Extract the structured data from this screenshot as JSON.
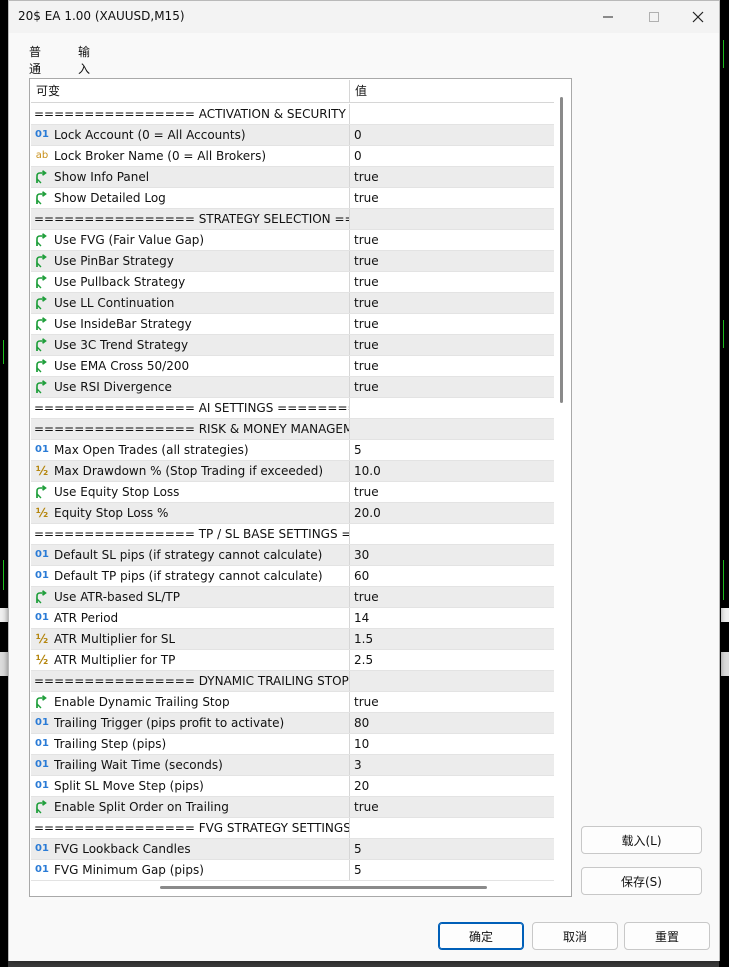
{
  "window": {
    "title": "20$ EA 1.00 (XAUUSD,M15)"
  },
  "tabs": [
    {
      "label": "普通"
    },
    {
      "label": "输入"
    }
  ],
  "grid": {
    "headers": {
      "variable": "可变",
      "value": "值"
    },
    "rows": [
      {
        "type": "sep",
        "name": "================ ACTIVATION & SECURITY =...",
        "value": ""
      },
      {
        "type": "int",
        "name": "Lock Account (0 = All Accounts)",
        "value": "0"
      },
      {
        "type": "str",
        "name": "Lock Broker Name (0 = All Brokers)",
        "value": "0"
      },
      {
        "type": "bool",
        "name": "Show Info Panel",
        "value": "true"
      },
      {
        "type": "bool",
        "name": "Show Detailed Log",
        "value": "true"
      },
      {
        "type": "sep",
        "name": "================ STRATEGY SELECTION ====...",
        "value": ""
      },
      {
        "type": "bool",
        "name": "Use FVG (Fair Value Gap)",
        "value": "true"
      },
      {
        "type": "bool",
        "name": "Use PinBar Strategy",
        "value": "true"
      },
      {
        "type": "bool",
        "name": "Use Pullback Strategy",
        "value": "true"
      },
      {
        "type": "bool",
        "name": "Use LL Continuation",
        "value": "true"
      },
      {
        "type": "bool",
        "name": "Use InsideBar Strategy",
        "value": "true"
      },
      {
        "type": "bool",
        "name": "Use 3C Trend Strategy",
        "value": "true"
      },
      {
        "type": "bool",
        "name": "Use EMA Cross 50/200",
        "value": "true"
      },
      {
        "type": "bool",
        "name": "Use RSI Divergence",
        "value": "true"
      },
      {
        "type": "sep",
        "name": "================ AI SETTINGS ==========...",
        "value": ""
      },
      {
        "type": "sep",
        "name": "================ RISK & MONEY MANAGEM...",
        "value": ""
      },
      {
        "type": "int",
        "name": "Max Open Trades (all strategies)",
        "value": "5"
      },
      {
        "type": "dbl",
        "name": "Max Drawdown % (Stop Trading if exceeded)",
        "value": "10.0"
      },
      {
        "type": "bool",
        "name": "Use Equity Stop Loss",
        "value": "true"
      },
      {
        "type": "dbl",
        "name": "Equity Stop Loss %",
        "value": "20.0"
      },
      {
        "type": "sep",
        "name": "================ TP / SL BASE SETTINGS ===...",
        "value": ""
      },
      {
        "type": "int",
        "name": "Default SL pips (if strategy cannot calculate)",
        "value": "30"
      },
      {
        "type": "int",
        "name": "Default TP pips (if strategy cannot calculate)",
        "value": "60"
      },
      {
        "type": "bool",
        "name": "Use ATR-based SL/TP",
        "value": "true"
      },
      {
        "type": "int",
        "name": "ATR Period",
        "value": "14"
      },
      {
        "type": "dbl",
        "name": "ATR Multiplier for SL",
        "value": "1.5"
      },
      {
        "type": "dbl",
        "name": "ATR Multiplier for TP",
        "value": "2.5"
      },
      {
        "type": "sep",
        "name": "================ DYNAMIC TRAILING STOP ...",
        "value": ""
      },
      {
        "type": "bool",
        "name": "Enable Dynamic Trailing Stop",
        "value": "true"
      },
      {
        "type": "int",
        "name": "Trailing Trigger (pips profit to activate)",
        "value": "80"
      },
      {
        "type": "int",
        "name": "Trailing Step (pips)",
        "value": "10"
      },
      {
        "type": "int",
        "name": "Trailing Wait Time (seconds)",
        "value": "3"
      },
      {
        "type": "int",
        "name": "Split SL Move Step (pips)",
        "value": "20"
      },
      {
        "type": "bool",
        "name": "Enable Split Order on Trailing",
        "value": "true"
      },
      {
        "type": "sep",
        "name": "================ FVG STRATEGY SETTINGS =...",
        "value": ""
      },
      {
        "type": "int",
        "name": "FVG Lookback Candles",
        "value": "5"
      },
      {
        "type": "int",
        "name": "FVG Minimum Gap (pips)",
        "value": "5"
      }
    ]
  },
  "icons": {
    "int": "01",
    "str": "ab",
    "dbl": "½",
    "bool": "bool-arrow-icon"
  },
  "colors": {
    "accent": "#0067c0",
    "bool_icon": "#1e9e3a",
    "int_icon": "#2a7bd6",
    "str_icon": "#c8901a"
  },
  "buttons": {
    "load": "载入(L)",
    "save": "保存(S)",
    "ok": "确定",
    "cancel": "取消",
    "reset": "重置"
  }
}
